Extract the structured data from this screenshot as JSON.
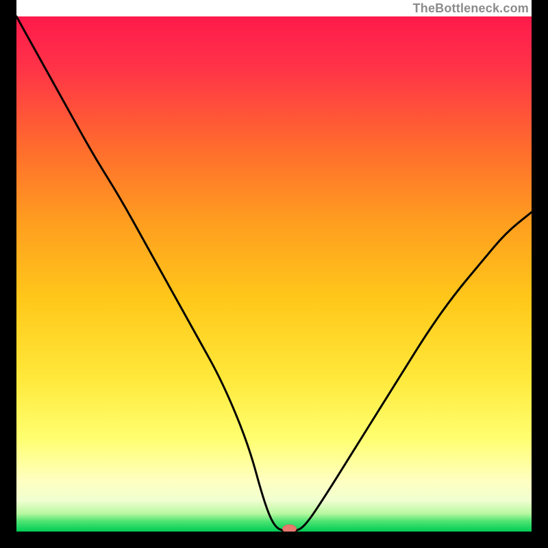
{
  "watermark": "TheBottleneck.com",
  "colors": {
    "frame": "#000000",
    "curve": "#000000",
    "marker_fill": "#e77a6f",
    "marker_stroke": "#d66a5e",
    "green_band": "#00d85a",
    "gradient_top": "#ff1744",
    "gradient_mid1": "#ff8a00",
    "gradient_mid2": "#ffd400",
    "gradient_mid3": "#ffff66",
    "gradient_bottom_pale": "#f8ffe0"
  },
  "chart_data": {
    "type": "line",
    "title": "",
    "xlabel": "",
    "ylabel": "",
    "xlim": [
      0,
      100
    ],
    "ylim": [
      0,
      100
    ],
    "x": [
      0,
      5,
      10,
      15,
      20,
      25,
      30,
      35,
      40,
      45,
      48,
      50,
      52,
      54,
      56,
      60,
      65,
      70,
      75,
      80,
      85,
      90,
      95,
      100
    ],
    "values": [
      100,
      91,
      82,
      73,
      65,
      56,
      47,
      38,
      29,
      17,
      6,
      1,
      0,
      0,
      1,
      7,
      15,
      23,
      31,
      39,
      46,
      52,
      58,
      62
    ],
    "marker": {
      "x": 53,
      "y": 0
    },
    "green_band_y": [
      0,
      3
    ]
  }
}
